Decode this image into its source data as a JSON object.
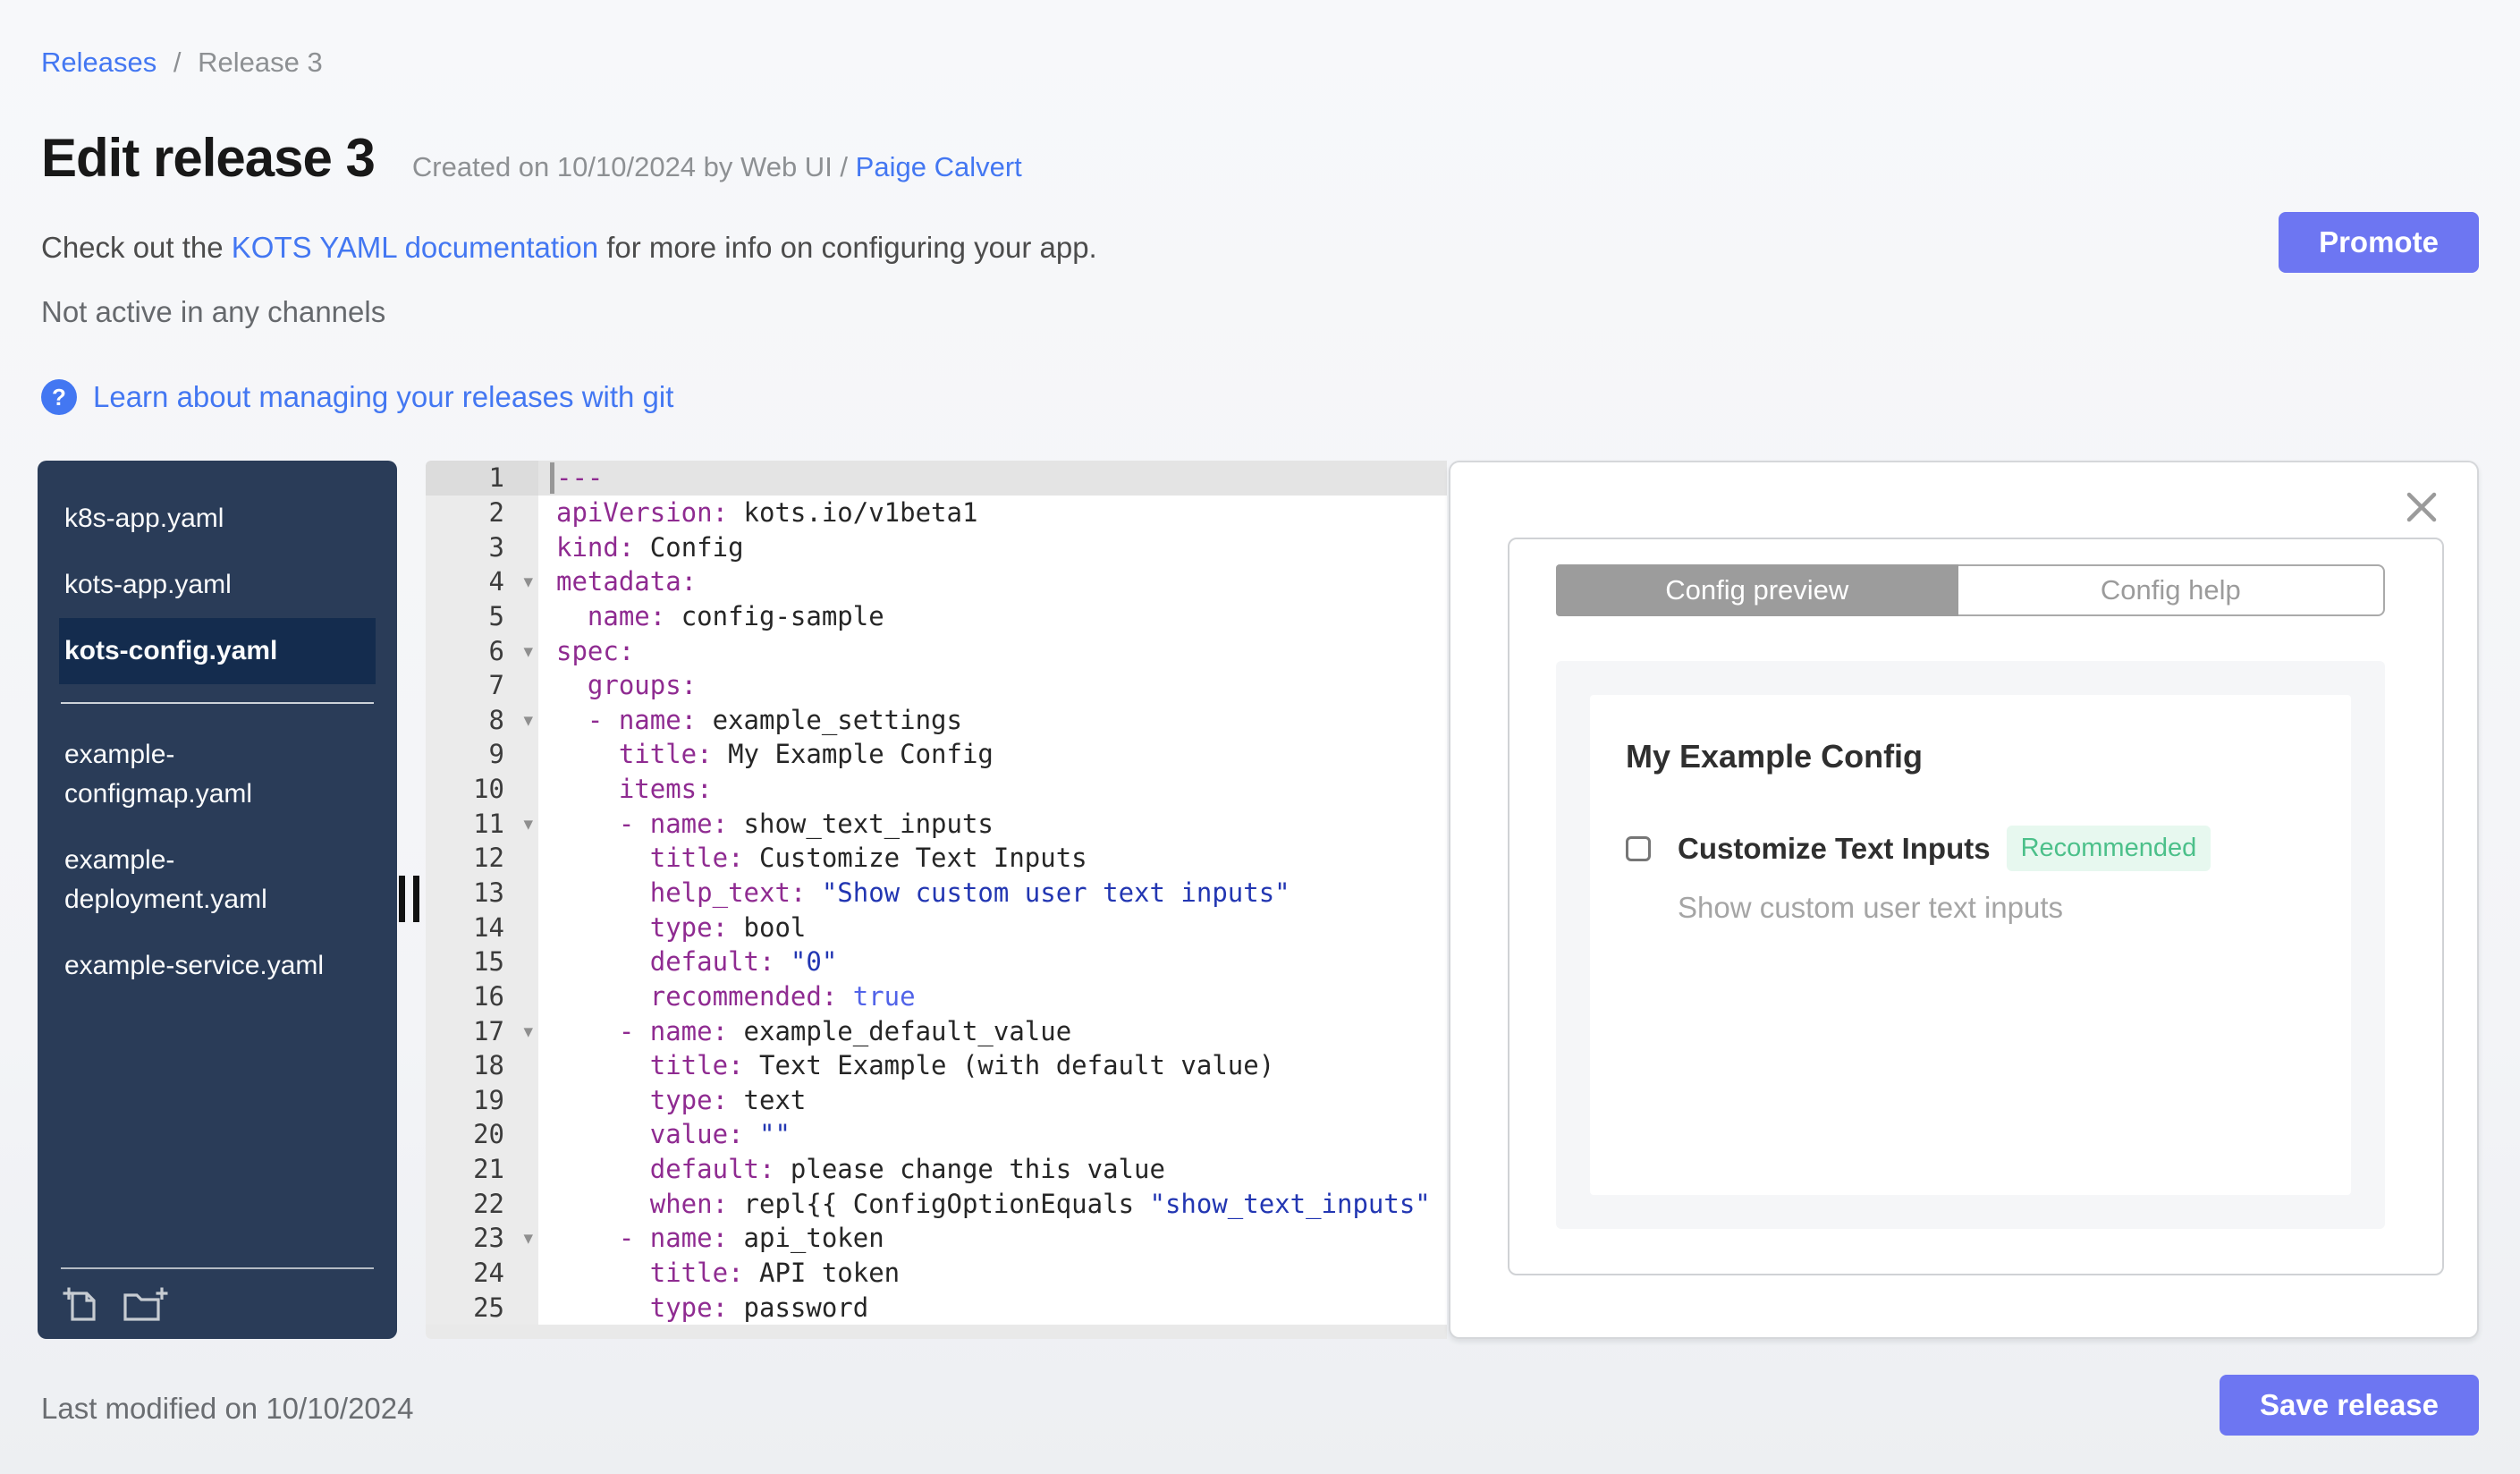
{
  "breadcrumb": {
    "link": "Releases",
    "separator": "/",
    "current": "Release 3"
  },
  "header": {
    "title": "Edit release 3",
    "created_prefix": "Created on 10/10/2024 by Web UI /",
    "created_author": "Paige Calvert",
    "description_pre": "Check out the ",
    "description_link": "KOTS YAML documentation",
    "description_post": " for more info on configuring your app.",
    "channel_status": "Not active in any channels",
    "learn_link": "Learn about managing your releases with git",
    "question_icon_glyph": "?",
    "promote_label": "Promote"
  },
  "sidebar": {
    "file_groups": [
      [
        {
          "label": "k8s-app.yaml",
          "selected": false
        },
        {
          "label": "kots-app.yaml",
          "selected": false
        },
        {
          "label": "kots-config.yaml",
          "selected": true
        }
      ],
      [
        {
          "label": "example-\nconfigmap.yaml",
          "selected": false
        },
        {
          "label": "example-\ndeployment.yaml",
          "selected": false
        },
        {
          "label": "example-service.yaml",
          "selected": false
        }
      ]
    ],
    "footer_icons": [
      "add-file-icon",
      "add-folder-icon"
    ]
  },
  "editor": {
    "fold_arrow_glyph": "▾",
    "lines": [
      {
        "active": true,
        "cursor": true,
        "fold": false,
        "segments": [
          {
            "t": "---",
            "c": "d"
          }
        ]
      },
      {
        "fold": false,
        "segments": [
          {
            "t": "apiVersion:",
            "c": "k"
          },
          {
            "t": " kots.io/v1beta1",
            "c": "p"
          }
        ]
      },
      {
        "fold": false,
        "segments": [
          {
            "t": "kind:",
            "c": "k"
          },
          {
            "t": " Config",
            "c": "p"
          }
        ]
      },
      {
        "fold": true,
        "segments": [
          {
            "t": "metadata:",
            "c": "k"
          }
        ]
      },
      {
        "fold": false,
        "segments": [
          {
            "t": "  ",
            "c": "p"
          },
          {
            "t": "name:",
            "c": "k"
          },
          {
            "t": " config-sample",
            "c": "p"
          }
        ]
      },
      {
        "fold": true,
        "segments": [
          {
            "t": "spec:",
            "c": "k"
          }
        ]
      },
      {
        "fold": false,
        "segments": [
          {
            "t": "  ",
            "c": "p"
          },
          {
            "t": "groups:",
            "c": "k"
          }
        ]
      },
      {
        "fold": true,
        "segments": [
          {
            "t": "  ",
            "c": "p"
          },
          {
            "t": "- name:",
            "c": "k"
          },
          {
            "t": " example_settings",
            "c": "p"
          }
        ]
      },
      {
        "fold": false,
        "segments": [
          {
            "t": "    ",
            "c": "p"
          },
          {
            "t": "title:",
            "c": "k"
          },
          {
            "t": " My Example Config",
            "c": "p"
          }
        ]
      },
      {
        "fold": false,
        "segments": [
          {
            "t": "    ",
            "c": "p"
          },
          {
            "t": "items:",
            "c": "k"
          }
        ]
      },
      {
        "fold": true,
        "segments": [
          {
            "t": "    ",
            "c": "p"
          },
          {
            "t": "- name:",
            "c": "k"
          },
          {
            "t": " show_text_inputs",
            "c": "p"
          }
        ]
      },
      {
        "fold": false,
        "segments": [
          {
            "t": "      ",
            "c": "p"
          },
          {
            "t": "title:",
            "c": "k"
          },
          {
            "t": " Customize Text Inputs",
            "c": "p"
          }
        ]
      },
      {
        "fold": false,
        "segments": [
          {
            "t": "      ",
            "c": "p"
          },
          {
            "t": "help_text:",
            "c": "k"
          },
          {
            "t": " \"Show custom user text inputs\"",
            "c": "s"
          }
        ]
      },
      {
        "fold": false,
        "segments": [
          {
            "t": "      ",
            "c": "p"
          },
          {
            "t": "type:",
            "c": "k"
          },
          {
            "t": " bool",
            "c": "p"
          }
        ]
      },
      {
        "fold": false,
        "segments": [
          {
            "t": "      ",
            "c": "p"
          },
          {
            "t": "default:",
            "c": "k"
          },
          {
            "t": " \"0\"",
            "c": "s"
          }
        ]
      },
      {
        "fold": false,
        "segments": [
          {
            "t": "      ",
            "c": "p"
          },
          {
            "t": "recommended:",
            "c": "k"
          },
          {
            "t": " true",
            "c": "b"
          }
        ]
      },
      {
        "fold": true,
        "segments": [
          {
            "t": "    ",
            "c": "p"
          },
          {
            "t": "- name:",
            "c": "k"
          },
          {
            "t": " example_default_value",
            "c": "p"
          }
        ]
      },
      {
        "fold": false,
        "segments": [
          {
            "t": "      ",
            "c": "p"
          },
          {
            "t": "title:",
            "c": "k"
          },
          {
            "t": " Text Example (with default value)",
            "c": "p"
          }
        ]
      },
      {
        "fold": false,
        "segments": [
          {
            "t": "      ",
            "c": "p"
          },
          {
            "t": "type:",
            "c": "k"
          },
          {
            "t": " text",
            "c": "p"
          }
        ]
      },
      {
        "fold": false,
        "segments": [
          {
            "t": "      ",
            "c": "p"
          },
          {
            "t": "value:",
            "c": "k"
          },
          {
            "t": " \"\"",
            "c": "s"
          }
        ]
      },
      {
        "fold": false,
        "segments": [
          {
            "t": "      ",
            "c": "p"
          },
          {
            "t": "default:",
            "c": "k"
          },
          {
            "t": " please change this value",
            "c": "p"
          }
        ]
      },
      {
        "fold": false,
        "segments": [
          {
            "t": "      ",
            "c": "p"
          },
          {
            "t": "when:",
            "c": "k"
          },
          {
            "t": " repl{{ ConfigOptionEquals ",
            "c": "p"
          },
          {
            "t": "\"show_text_inputs\"",
            "c": "s"
          }
        ]
      },
      {
        "fold": true,
        "segments": [
          {
            "t": "    ",
            "c": "p"
          },
          {
            "t": "- name:",
            "c": "k"
          },
          {
            "t": " api_token",
            "c": "p"
          }
        ]
      },
      {
        "fold": false,
        "segments": [
          {
            "t": "      ",
            "c": "p"
          },
          {
            "t": "title:",
            "c": "k"
          },
          {
            "t": " API token",
            "c": "p"
          }
        ]
      },
      {
        "fold": false,
        "segments": [
          {
            "t": "      ",
            "c": "p"
          },
          {
            "t": "type:",
            "c": "k"
          },
          {
            "t": " password",
            "c": "p"
          }
        ]
      }
    ]
  },
  "panel": {
    "tabs": [
      {
        "label": "Config preview",
        "active": true
      },
      {
        "label": "Config help",
        "active": false
      }
    ],
    "preview": {
      "group_title": "My Example Config",
      "item_label": "Customize Text Inputs",
      "badge": "Recommended",
      "help_text": "Show custom user text inputs",
      "checkbox_checked": false
    }
  },
  "footer": {
    "last_modified": "Last modified on 10/10/2024",
    "save_label": "Save release"
  },
  "colors": {
    "accent_button": "#6d76f2",
    "link_blue": "#4377f2",
    "sidebar_bg": "#2a3c58",
    "sidebar_selected_bg": "#142c4e",
    "badge_text": "#4cc08a",
    "badge_bg": "#e7f8ef",
    "yaml_key": "#8f2b91",
    "yaml_string": "#2236b2",
    "yaml_bool": "#5163e8",
    "tab_active_bg": "#9c9c9c"
  }
}
